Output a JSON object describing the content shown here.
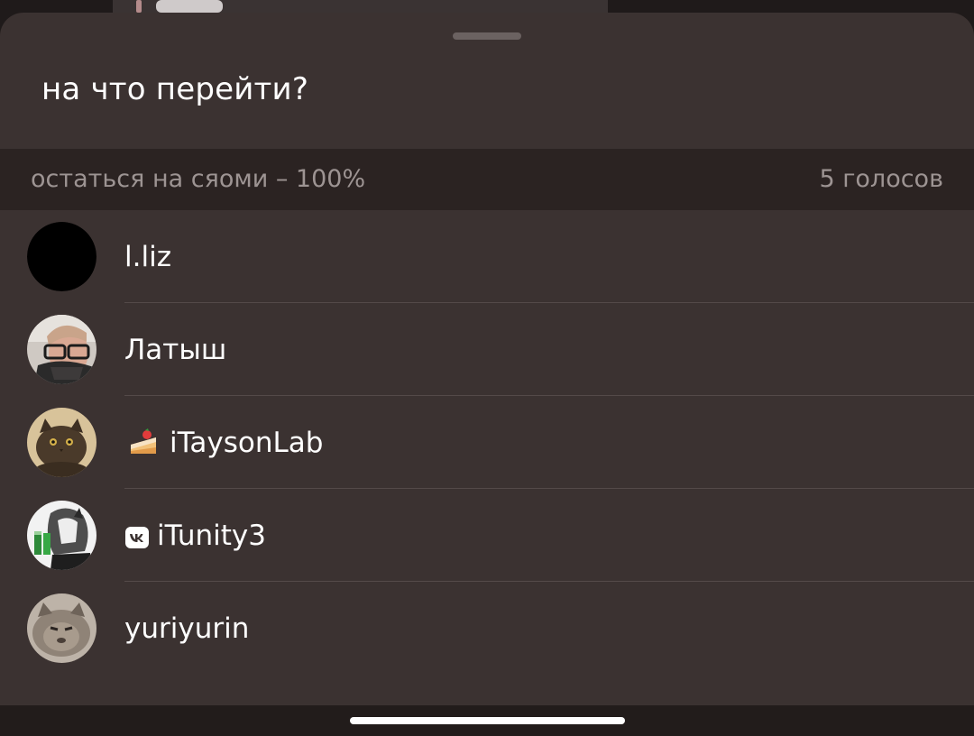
{
  "poll": {
    "question": "на что перейти?",
    "result": {
      "option": "остаться на сяоми – 100%",
      "votes": "5 голосов",
      "percent": 100
    }
  },
  "voters": [
    {
      "name": "l.liz"
    },
    {
      "name": "Латыш"
    },
    {
      "name": "iTaysonLab",
      "badge_icon": "cake-icon"
    },
    {
      "name": "iTunity3",
      "badge_icon": "vk-icon"
    },
    {
      "name": "yuriyurin"
    }
  ],
  "colors": {
    "sheet_background": "#3b3231",
    "result_bar_background": "#2b2322",
    "primary_text": "#ffffff",
    "secondary_text": "#9d9493"
  }
}
